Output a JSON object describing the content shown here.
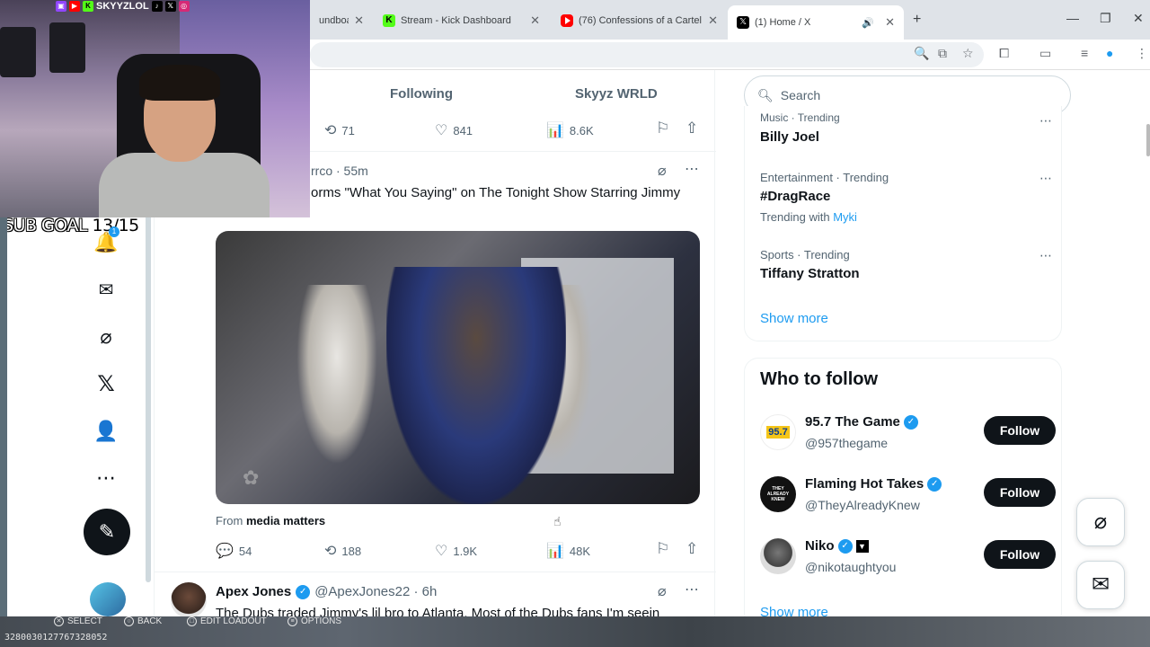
{
  "browser": {
    "tabs": [
      {
        "title": "undboa",
        "favicon": "generic-icon"
      },
      {
        "title": "Stream - Kick Dashboard",
        "favicon": "kick-icon"
      },
      {
        "title": "(76) Confessions of a Cartel Co",
        "favicon": "youtube-icon"
      },
      {
        "title": "(1) Home / X",
        "favicon": "x-icon"
      }
    ],
    "new_tab_symbol": "+",
    "tab_close_symbol": "✕"
  },
  "feed": {
    "tabs": [
      "Following",
      "Skyyz WRLD"
    ],
    "top_actions": {
      "retweets": "71",
      "likes": "841",
      "views": "8.6K"
    },
    "post1": {
      "handle_time": "rrco · 55m",
      "text": "orms \"What You Saying\" on The Tonight Show Starring Jimmy",
      "source_prefix": "From",
      "source_name": "media matters",
      "replies": "54",
      "retweets": "188",
      "likes": "1.9K",
      "views": "48K"
    },
    "post2": {
      "name": "Apex Jones",
      "handle_time": "@ApexJones22 · 6h",
      "text": "The Dubs traded Jimmy's lil bro to Atlanta. Most of the Dubs fans I'm seein"
    }
  },
  "sidebar": {
    "search_placeholder": "Search",
    "trends": [
      {
        "meta": "Music · Trending",
        "name": "Billy Joel"
      },
      {
        "meta": "Entertainment · Trending",
        "name": "#DragRace",
        "extra_prefix": "Trending with",
        "extra_link": "Myki"
      },
      {
        "meta": "Sports · Trending",
        "name": "Tiffany Stratton"
      }
    ],
    "show_more": "Show more",
    "who_to_follow": {
      "title": "Who to follow",
      "accounts": [
        {
          "name": "95.7 The Game",
          "handle": "@957thegame",
          "button": "Follow",
          "avatar_text": "95.7"
        },
        {
          "name": "Flaming Hot Takes",
          "handle": "@TheyAlreadyKnew",
          "button": "Follow",
          "avatar_text": "THEY ALREADY KNEW"
        },
        {
          "name": "Niko",
          "handle": "@nikotaughtyou",
          "button": "Follow"
        }
      ],
      "show_more": "Show more"
    }
  },
  "overlay": {
    "channel_name": "SKYYZLOL",
    "sub_goal_label": "SUB GOAL",
    "sub_goal_value": "13/15",
    "notification_count": "1",
    "hints": [
      "SELECT",
      "BACK",
      "EDIT LOADOUT",
      "OPTIONS"
    ],
    "session_id": "3280030127767328052"
  },
  "colors": {
    "accent": "#1d9bf0",
    "text": "#0f1419",
    "muted": "#536471",
    "kick": "#53fc18"
  }
}
